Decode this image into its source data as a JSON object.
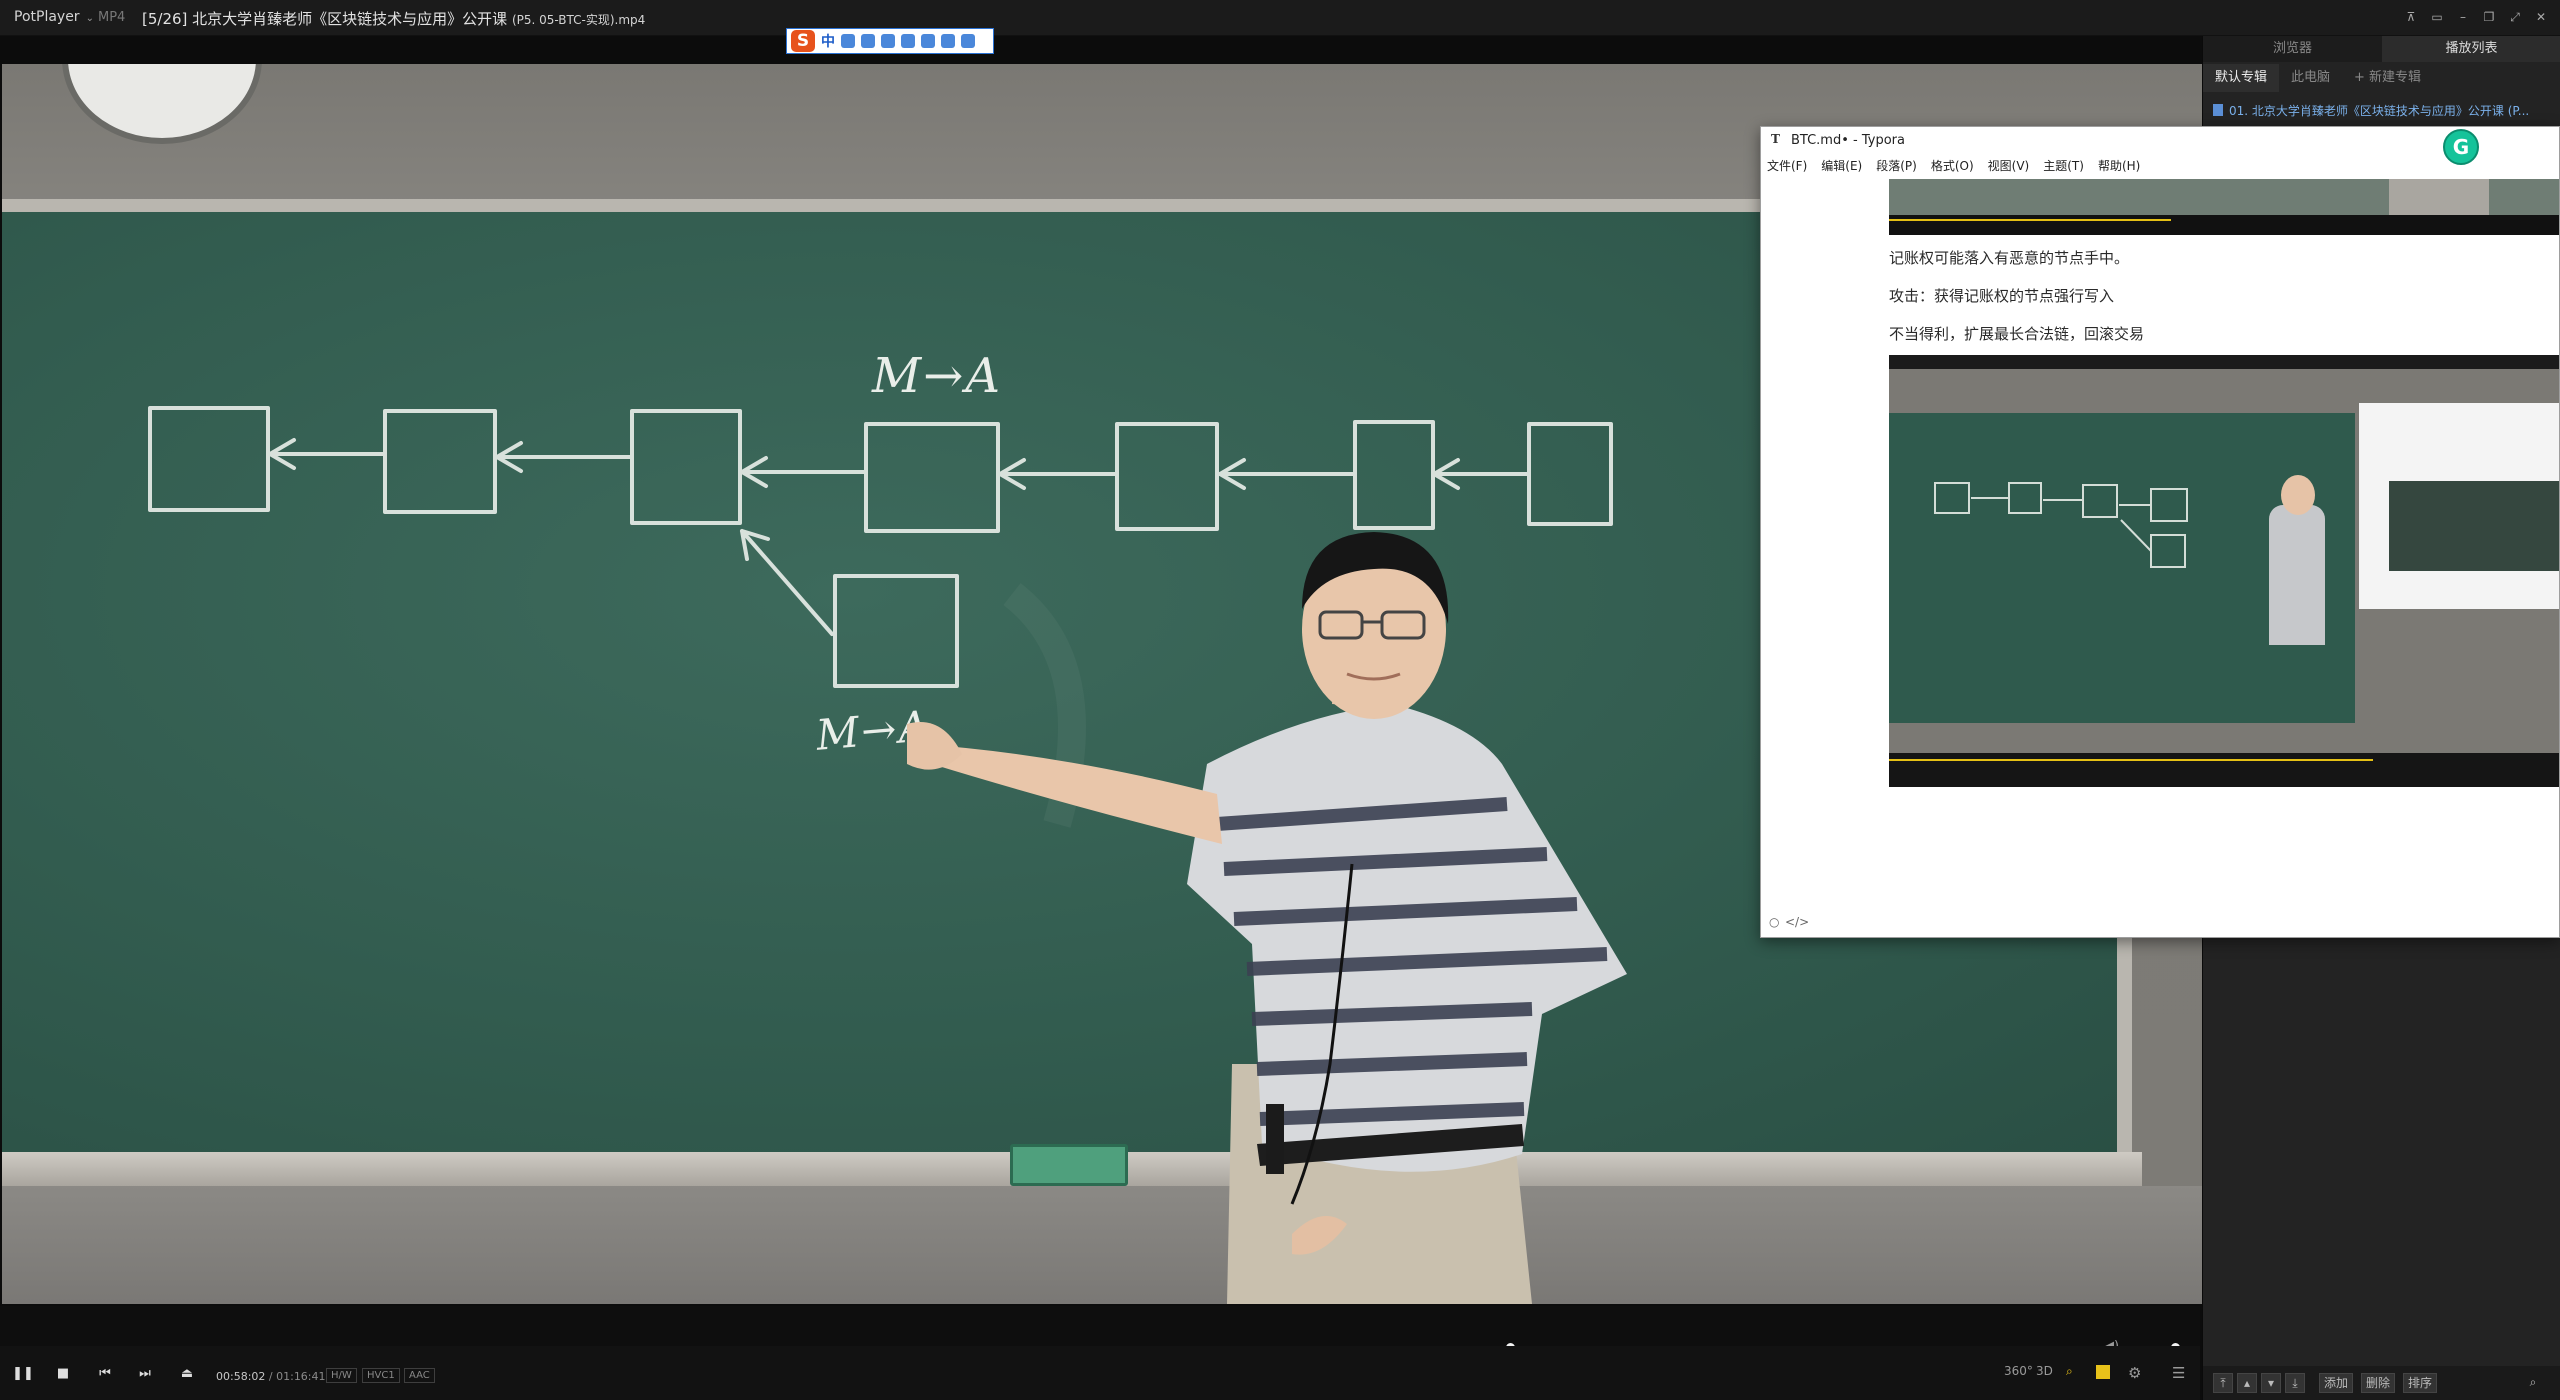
{
  "titlebar": {
    "app_name": "PotPlayer",
    "format": "MP4",
    "file_name": "[5/26] 北京大学肖臻老师《区块链技术与应用》公开课 ",
    "file_suffix": "(P5. 05-BTC-实现).mp4",
    "window_buttons": [
      "pin",
      "mini",
      "minimize",
      "restore",
      "fullscreen",
      "close"
    ]
  },
  "ime_toolbar": {
    "logo": "S",
    "mode": "中",
    "icons": [
      "punct-icon",
      "emoji-icon",
      "mic-icon",
      "keyboard-icon",
      "user-icon",
      "skin-icon",
      "grid-icon"
    ]
  },
  "video": {
    "chalk_labels": {
      "top_label": "M→A",
      "bottom_label": "M→A"
    }
  },
  "player": {
    "position": "00:58:02",
    "duration": "01:16:41",
    "progress_fraction": 0.72,
    "volume_fraction": 0.8,
    "badges": [
      "H/W",
      "HVC1",
      "AAC"
    ],
    "right_labels": [
      "360°",
      "3D"
    ]
  },
  "playlist": {
    "tabs": [
      "浏览器",
      "播放列表"
    ],
    "active_tab": "播放列表",
    "subtabs": [
      "默认专辑",
      "此电脑",
      "+ 新建专辑"
    ],
    "items": [
      "01. 北京大学肖臻老师《区块链技术与应用》公开课 (P..."
    ],
    "bottom_buttons": [
      "添加",
      "删除",
      "排序"
    ]
  },
  "typora": {
    "title": "BTC.md• - Typora",
    "icon": "T",
    "menu": [
      "文件(F)",
      "编辑(E)",
      "段落(P)",
      "格式(O)",
      "视图(V)",
      "主题(T)",
      "帮助(H)"
    ],
    "paragraphs": [
      "记账权可能落入有恶意的节点手中。",
      "攻击：获得记账权的节点强行写入",
      "不当得利，扩展最长合法链，回滚交易"
    ],
    "footer": [
      "○",
      "</>"
    ],
    "grammarly": "G"
  },
  "colors": {
    "accent": "#e8c21a",
    "board": "#325c4f",
    "typora_bg": "#ffffff",
    "grammarly": "#15c39a"
  }
}
